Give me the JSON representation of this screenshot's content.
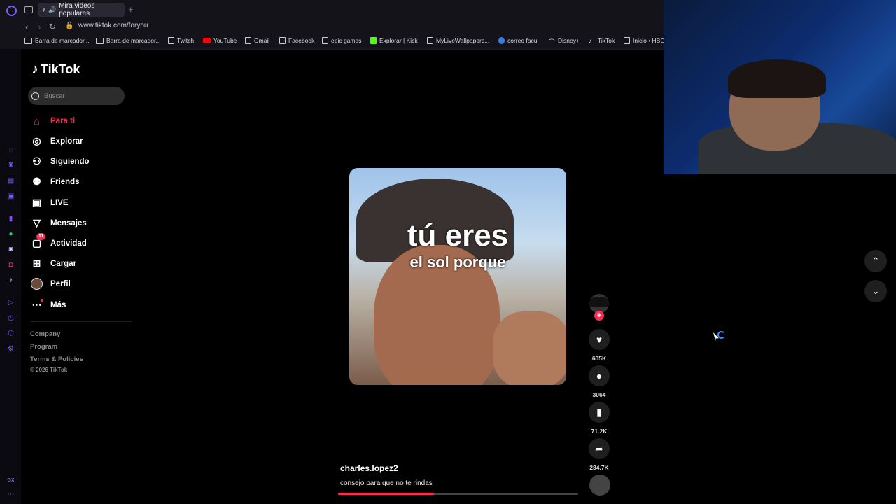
{
  "browser": {
    "tab_title": "Mira videos populares",
    "new_tab": "+",
    "url": "www.tiktok.com/foryou",
    "bookmarks": [
      "Barra de marcador...",
      "Barra de marcador...",
      "Twitch",
      "YouTube",
      "Gmail",
      "Facebook",
      "epic games",
      "Explorar | Kick",
      "MyLiveWallpapers...",
      "correo facu",
      "Disney+",
      "TikTok",
      "Inicio • HBO"
    ],
    "sidebar_footer": "GX"
  },
  "tiktok": {
    "logo": "TikTok",
    "search_placeholder": "Buscar",
    "menu": [
      {
        "label": "Para ti",
        "icon": "home-icon",
        "active": true
      },
      {
        "label": "Explorar",
        "icon": "compass-icon"
      },
      {
        "label": "Siguiendo",
        "icon": "following-icon"
      },
      {
        "label": "Friends",
        "icon": "friends-icon"
      },
      {
        "label": "LIVE",
        "icon": "live-icon"
      },
      {
        "label": "Mensajes",
        "icon": "messages-icon"
      },
      {
        "label": "Actividad",
        "icon": "activity-icon",
        "badge": "11"
      },
      {
        "label": "Cargar",
        "icon": "upload-icon"
      },
      {
        "label": "Perfil",
        "icon": "avatar"
      },
      {
        "label": "Más",
        "icon": "more-icon"
      }
    ],
    "footer": {
      "company": "Company",
      "program": "Program",
      "terms": "Terms & Policies",
      "copyright": "© 2026 TikTok"
    }
  },
  "video": {
    "caption_line1": "tú eres",
    "caption_line2": "el sol porque",
    "author": "charles.lopez2",
    "description": "consejo para que no te rindas",
    "progress": 0.4,
    "likes": "605K",
    "comments": "3064",
    "saves": "71.2K",
    "shares": "284.7K"
  },
  "colors": {
    "accent": "#fe2c55",
    "opera_purple": "#7d5cff"
  }
}
